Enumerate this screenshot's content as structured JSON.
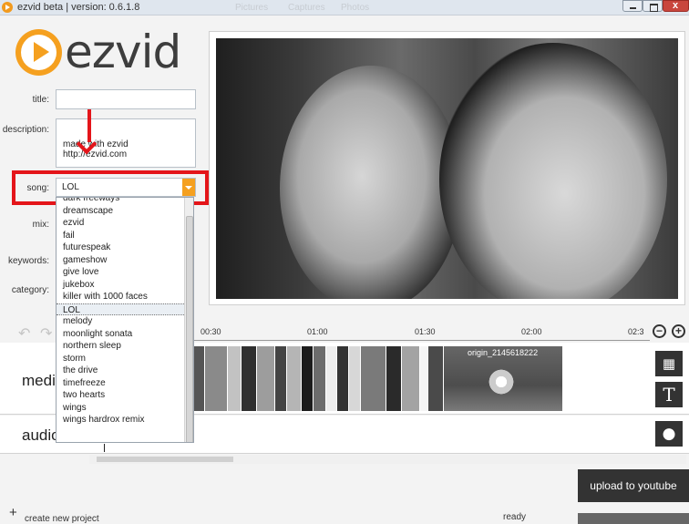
{
  "window": {
    "title": "ezvid beta | version: 0.6.1.8",
    "ghost_menu": [
      "Pictures",
      "Captures",
      "Photos"
    ]
  },
  "logo": {
    "text": "ezvid",
    "color": "#f5a01f"
  },
  "form": {
    "title_label": "title:",
    "title_value": "",
    "description_label": "description:",
    "description_value": "made with ezvid http://ezvid.com",
    "song_label": "song:",
    "song_value": "LOL",
    "mix_label": "mix:",
    "keywords_label": "keywords:",
    "category_label": "category:"
  },
  "song_dropdown": {
    "items": [
      "dark freeways",
      "dreamscape",
      "ezvid",
      "fail",
      "futurespeak",
      "gameshow",
      "give love",
      "jukebox",
      "killer with 1000 faces",
      "LOL",
      "melody",
      "moonlight sonata",
      "northern sleep",
      "storm",
      "the drive",
      "timefreeze",
      "two hearts",
      "wings",
      "wings hardrox remix"
    ],
    "selected": "LOL"
  },
  "timeline": {
    "ticks": [
      "00:30",
      "01:00",
      "01:30",
      "02:00",
      "02:3"
    ],
    "media_label": "media",
    "audio_label": "audio",
    "clip_label": "origin_2145618222"
  },
  "toolbar": {
    "upload_label": "upload to youtube",
    "create_label": "create new project",
    "status": "ready"
  },
  "icons": {
    "film": "film-icon",
    "text": "T",
    "mic": "microphone-icon",
    "zoom_out": "−",
    "zoom_in": "+"
  },
  "colors": {
    "accent": "#f5a01f",
    "highlight": "#e4151a",
    "dark_button": "#333333"
  }
}
